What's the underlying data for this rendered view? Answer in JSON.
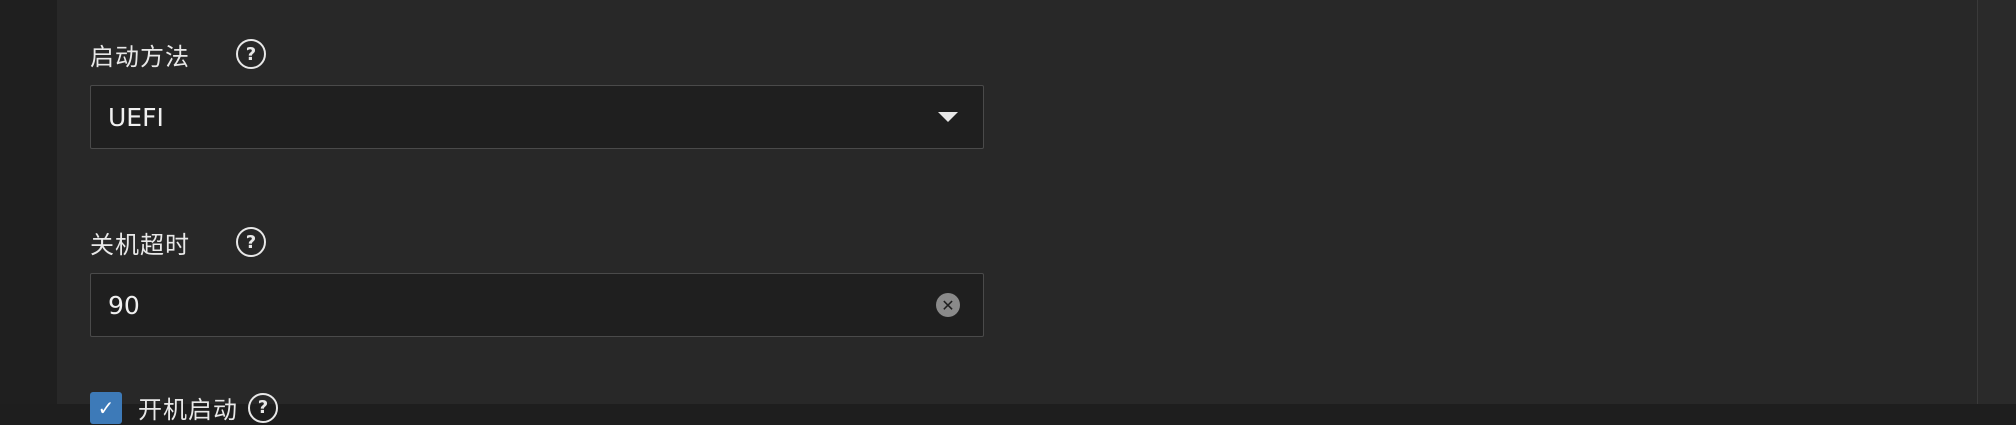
{
  "boot_method": {
    "label": "启动方法",
    "value": "UEFI"
  },
  "shutdown_timeout": {
    "label": "关机超时",
    "value": "90"
  },
  "autostart": {
    "label": "开机启动",
    "checked": true
  },
  "icons": {
    "help": "?",
    "clear": "✕",
    "check": "✓"
  }
}
